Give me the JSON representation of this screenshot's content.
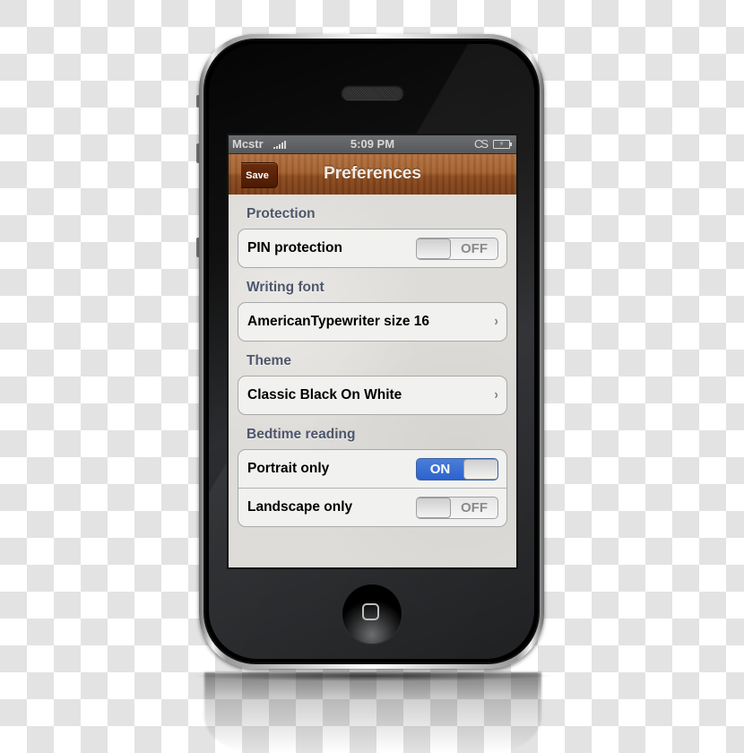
{
  "status_bar": {
    "carrier": "Mcstr",
    "signal_bars": 5,
    "time": "5:09 PM",
    "app_indicator": "CS",
    "battery_icon": "battery-charging-icon"
  },
  "nav_bar": {
    "back_button_label": "Save",
    "title": "Preferences"
  },
  "sections": [
    {
      "header": "Protection",
      "rows": [
        {
          "label": "PIN protection",
          "type": "toggle",
          "state_label": "OFF",
          "on": false
        }
      ]
    },
    {
      "header": "Writing font",
      "rows": [
        {
          "label": "AmericanTypewriter size 16",
          "type": "disclosure",
          "accessory": "chevron-right-icon"
        }
      ]
    },
    {
      "header": "Theme",
      "rows": [
        {
          "label": "Classic Black On White",
          "type": "disclosure",
          "accessory": "chevron-right-icon"
        }
      ]
    },
    {
      "header": "Bedtime reading",
      "rows": [
        {
          "label": "Portrait only",
          "type": "toggle",
          "state_label": "ON",
          "on": true
        },
        {
          "label": "Landscape only",
          "type": "toggle",
          "state_label": "OFF",
          "on": false
        }
      ]
    }
  ],
  "colors": {
    "nav_wood": "#a4612f",
    "section_header": "#4c566a",
    "toggle_on": "#2c62cc"
  },
  "glyphs": {
    "chevron": "›"
  }
}
